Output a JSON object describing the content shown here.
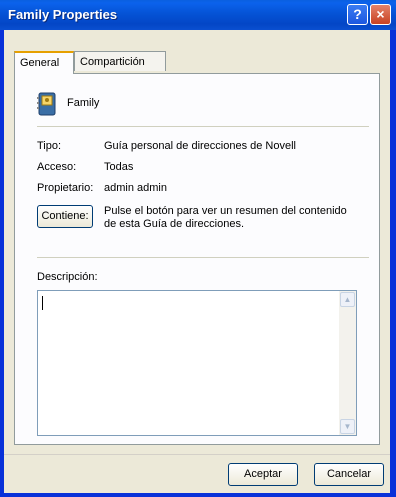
{
  "window": {
    "title": "Family Properties",
    "help_icon": "?",
    "close_icon": "×"
  },
  "tabs": [
    {
      "label": "General",
      "active": true
    },
    {
      "label": "Compartición",
      "active": false
    }
  ],
  "header": {
    "name": "Family",
    "icon": "address-book-icon"
  },
  "fields": {
    "tipo_label": "Tipo:",
    "tipo_value": "Guía personal de direcciones de Novell",
    "acceso_label": "Acceso:",
    "acceso_value": "Todas",
    "propietario_label": "Propietario:",
    "propietario_value": "admin admin"
  },
  "contiene": {
    "button_label": "Contiene:",
    "description_line1": "Pulse el botón para ver un resumen del contenido",
    "description_line2": "de esta Guía de direcciones."
  },
  "descripcion": {
    "label": "Descripción:",
    "value": ""
  },
  "buttons": {
    "ok": "Aceptar",
    "cancel": "Cancelar"
  }
}
